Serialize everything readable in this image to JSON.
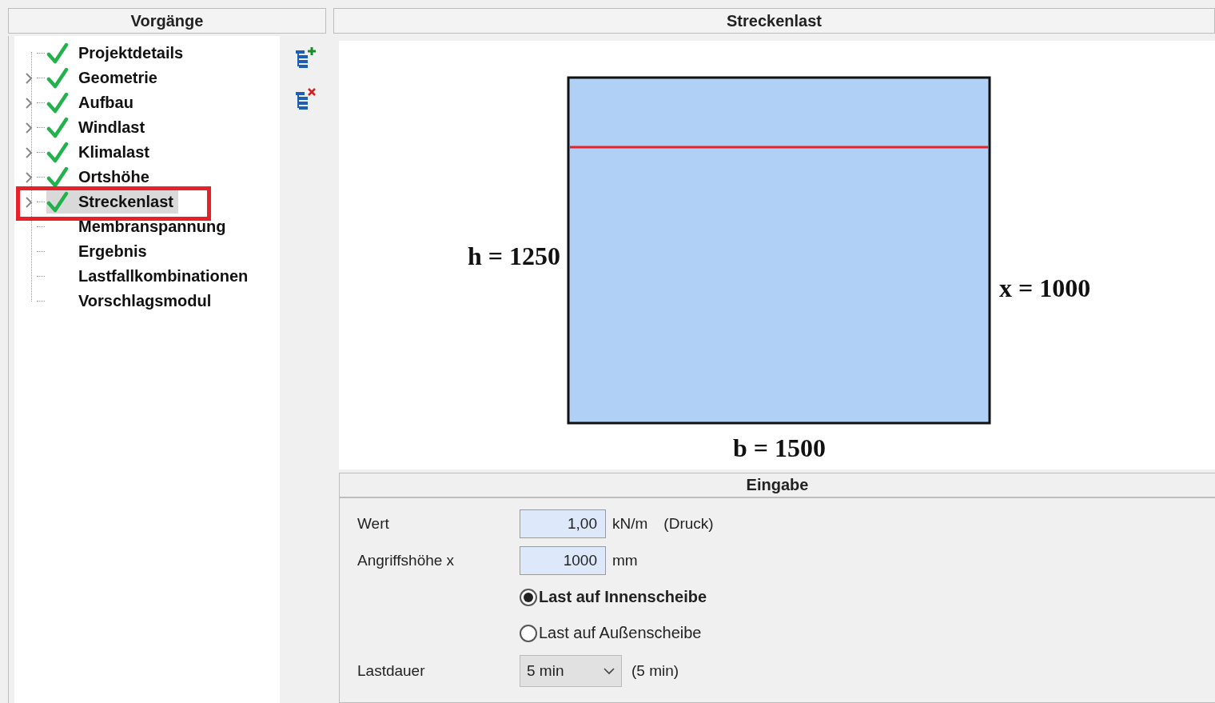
{
  "left_panel": {
    "title": "Vorgänge",
    "items": [
      {
        "label": "Projektdetails",
        "expandable": false,
        "done": true,
        "selected": false,
        "annotated": false
      },
      {
        "label": "Geometrie",
        "expandable": true,
        "done": true,
        "selected": false,
        "annotated": false
      },
      {
        "label": "Aufbau",
        "expandable": true,
        "done": true,
        "selected": false,
        "annotated": false
      },
      {
        "label": "Windlast",
        "expandable": true,
        "done": true,
        "selected": false,
        "annotated": false
      },
      {
        "label": "Klimalast",
        "expandable": true,
        "done": true,
        "selected": false,
        "annotated": false
      },
      {
        "label": "Ortshöhe",
        "expandable": true,
        "done": true,
        "selected": false,
        "annotated": false
      },
      {
        "label": "Streckenlast",
        "expandable": true,
        "done": true,
        "selected": true,
        "annotated": true
      },
      {
        "label": "Membranspannung",
        "expandable": false,
        "done": false,
        "selected": false,
        "annotated": false
      },
      {
        "label": "Ergebnis",
        "expandable": false,
        "done": false,
        "selected": false,
        "annotated": false
      },
      {
        "label": "Lastfallkombinationen",
        "expandable": false,
        "done": false,
        "selected": false,
        "annotated": false
      },
      {
        "label": "Vorschlagsmodul",
        "expandable": false,
        "done": false,
        "selected": false,
        "annotated": false
      }
    ],
    "toolbar": [
      {
        "kind": "add"
      },
      {
        "kind": "remove"
      }
    ]
  },
  "right_panel": {
    "title": "Streckenlast",
    "drawing": {
      "height_label": "h = 1250",
      "position_label": "x = 1000",
      "width_label": "b = 1500"
    },
    "input": {
      "title": "Eingabe",
      "fields": [
        {
          "label": "Wert",
          "value": "1,00",
          "unit": "kN/m",
          "note": "(Druck)"
        },
        {
          "label": "Angriffshöhe x",
          "value": "1000",
          "unit": "mm"
        }
      ],
      "options": [
        {
          "label": "Last auf Innenscheibe",
          "selected": true
        },
        {
          "label": "Last auf Außenscheibe",
          "selected": false
        }
      ],
      "duration": {
        "label": "Lastdauer",
        "value": "5 min",
        "note": "(5 min)"
      }
    }
  }
}
